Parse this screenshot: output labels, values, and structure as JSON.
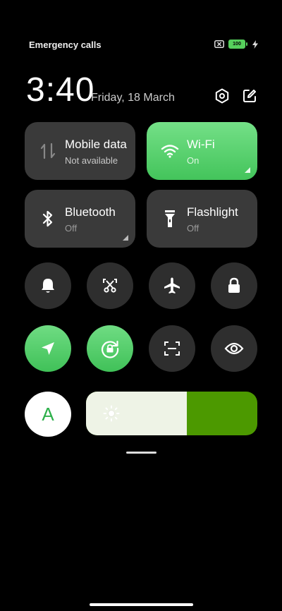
{
  "status_bar": {
    "carrier": "Emergency calls",
    "battery_level": "100",
    "icons": [
      "sim-error-icon",
      "battery-icon",
      "charging-bolt-icon"
    ]
  },
  "header": {
    "time": "3:40",
    "date": "Friday, 18 March",
    "icons": [
      "settings-icon",
      "edit-icon"
    ]
  },
  "tiles": [
    {
      "name": "Mobile data",
      "state": "Not available",
      "icon": "mobile-data-arrows-icon",
      "active": false
    },
    {
      "name": "Wi-Fi",
      "state": "On",
      "icon": "wifi-icon",
      "active": true
    },
    {
      "name": "Bluetooth",
      "state": "Off",
      "icon": "bluetooth-icon",
      "active": false
    },
    {
      "name": "Flashlight",
      "state": "Off",
      "icon": "flashlight-icon",
      "active": false
    }
  ],
  "toggles_row1": [
    {
      "icon": "bell-icon",
      "active": false
    },
    {
      "icon": "screenshot-scissors-icon",
      "active": false
    },
    {
      "icon": "airplane-icon",
      "active": false
    },
    {
      "icon": "lock-icon",
      "active": false
    }
  ],
  "toggles_row2": [
    {
      "icon": "location-arrow-icon",
      "active": true
    },
    {
      "icon": "rotation-lock-icon",
      "active": true
    },
    {
      "icon": "scanner-icon",
      "active": false
    },
    {
      "icon": "eye-icon",
      "active": false
    }
  ],
  "font_button": {
    "label": "A"
  },
  "brightness": {
    "level": 0.59,
    "icon": "sun-icon"
  },
  "colors": {
    "accent": "#43c45b",
    "brightness_bg": "#4c9900",
    "tile_off": "#3a3a3a"
  }
}
